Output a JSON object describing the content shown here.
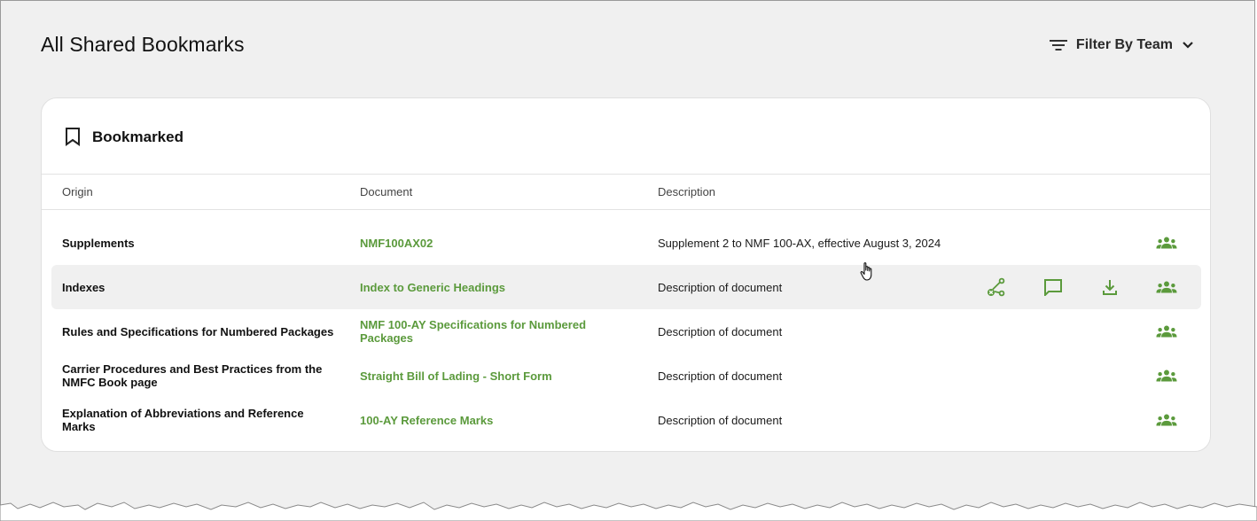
{
  "page": {
    "title": "All Shared Bookmarks"
  },
  "filter": {
    "label": "Filter By Team",
    "icon": "filter-icon",
    "chevron": "chevron-down-icon"
  },
  "card": {
    "title": "Bookmarked",
    "icon": "bookmark-icon",
    "columns": {
      "origin": "Origin",
      "document": "Document",
      "description": "Description"
    },
    "rows": [
      {
        "origin": "Supplements",
        "document": "NMF100AX02",
        "description": "Supplement 2 to NMF 100-AX, effective August 3, 2024",
        "hovered": false
      },
      {
        "origin": "Indexes",
        "document": "Index to Generic Headings",
        "description": "Description of document",
        "hovered": true
      },
      {
        "origin": "Rules and Specifications for Numbered Packages",
        "document": "NMF 100-AY Specifications for Numbered Packages",
        "description": "Description of document",
        "hovered": false
      },
      {
        "origin": "Carrier Procedures and Best Practices from the NMFC Book page",
        "document": "Straight Bill of Lading - Short Form",
        "description": "Description of document",
        "hovered": false
      },
      {
        "origin": "Explanation of Abbreviations and Reference Marks",
        "document": "100-AY Reference Marks",
        "description": "Description of document",
        "hovered": false
      }
    ],
    "row_actions": [
      "unlink-icon",
      "comment-icon",
      "download-icon",
      "shared-team-icon"
    ]
  },
  "colors": {
    "accent": "#5b9a3c",
    "background": "#f0f0f0",
    "card": "#ffffff",
    "hover_row": "#f0f0f0"
  }
}
